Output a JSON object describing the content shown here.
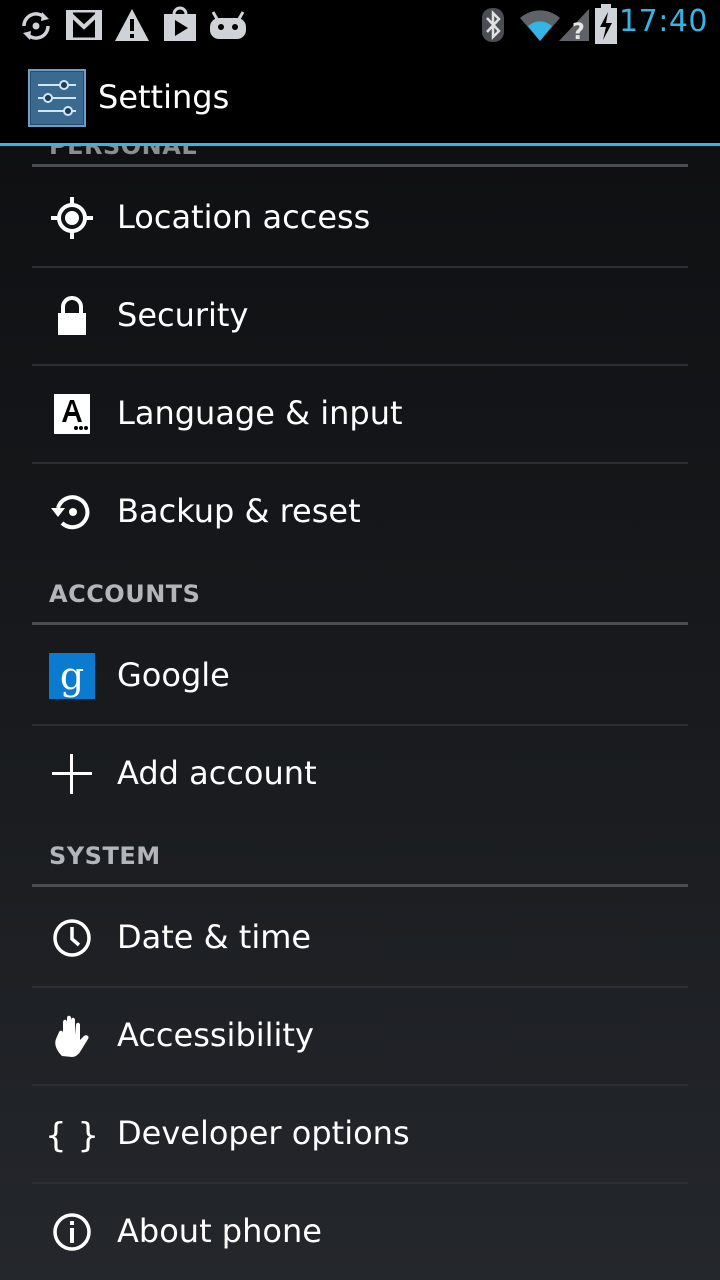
{
  "status_bar": {
    "time": "17:40",
    "left_icons": [
      "sync-icon",
      "gmail-icon",
      "warning-icon",
      "play-store-icon",
      "android-icon"
    ],
    "right_icons": [
      "bluetooth-icon",
      "wifi-icon",
      "no-sim-signal-icon",
      "battery-charging-icon"
    ]
  },
  "action_bar": {
    "title": "Settings"
  },
  "sections": {
    "personal_cut": "PERSONAL",
    "accounts": "ACCOUNTS",
    "system": "SYSTEM"
  },
  "items": {
    "location": "Location access",
    "security": "Security",
    "language": "Language & input",
    "backup": "Backup & reset",
    "google": "Google",
    "add_account": "Add account",
    "date_time": "Date & time",
    "accessibility": "Accessibility",
    "developer": "Developer options",
    "about": "About phone"
  },
  "colors": {
    "accent": "#33b5e5",
    "google_badge": "#0b7bd0"
  }
}
